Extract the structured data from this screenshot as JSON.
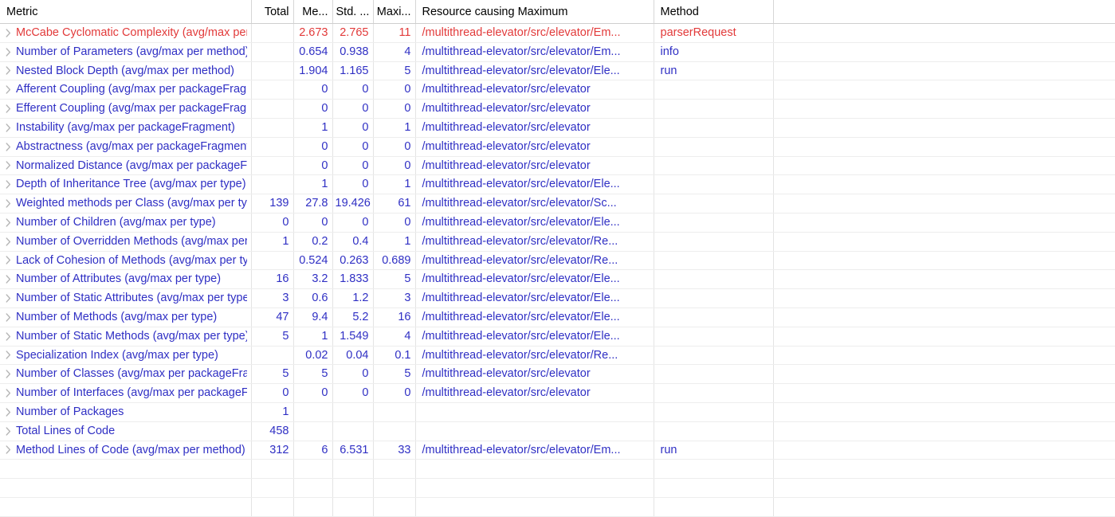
{
  "table": {
    "columns": [
      {
        "key": "metric",
        "label": "Metric",
        "align": "left"
      },
      {
        "key": "total",
        "label": "Total",
        "align": "right"
      },
      {
        "key": "mean",
        "label": "Me...",
        "align": "right"
      },
      {
        "key": "std",
        "label": "Std. ...",
        "align": "right"
      },
      {
        "key": "max",
        "label": "Maxi...",
        "align": "right"
      },
      {
        "key": "resource",
        "label": "Resource causing Maximum",
        "align": "left"
      },
      {
        "key": "method",
        "label": "Method",
        "align": "left"
      },
      {
        "key": "filler",
        "label": "",
        "align": "left"
      }
    ],
    "expander_icon": "chevron-right-icon",
    "colors": {
      "row_normal": "#2f2fc4",
      "row_highlight": "#e23a3a",
      "header_text": "#000000",
      "grid_line": "#e4e4e4",
      "expander": "#b4b4b4"
    },
    "rows": [
      {
        "metric": "McCabe Cyclomatic Complexity (avg/max per method)",
        "total": "",
        "mean": "2.673",
        "std": "2.765",
        "max": "11",
        "resource": "/multithread-elevator/src/elevator/Em...",
        "method": "parserRequest",
        "state": "highlight"
      },
      {
        "metric": "Number of Parameters (avg/max per method)",
        "total": "",
        "mean": "0.654",
        "std": "0.938",
        "max": "4",
        "resource": "/multithread-elevator/src/elevator/Em...",
        "method": "info",
        "state": "normal"
      },
      {
        "metric": "Nested Block Depth (avg/max per method)",
        "total": "",
        "mean": "1.904",
        "std": "1.165",
        "max": "5",
        "resource": "/multithread-elevator/src/elevator/Ele...",
        "method": "run",
        "state": "normal"
      },
      {
        "metric": "Afferent Coupling (avg/max per packageFragment)",
        "total": "",
        "mean": "0",
        "std": "0",
        "max": "0",
        "resource": "/multithread-elevator/src/elevator",
        "method": "",
        "state": "normal"
      },
      {
        "metric": "Efferent Coupling (avg/max per packageFragment)",
        "total": "",
        "mean": "0",
        "std": "0",
        "max": "0",
        "resource": "/multithread-elevator/src/elevator",
        "method": "",
        "state": "normal"
      },
      {
        "metric": "Instability (avg/max per packageFragment)",
        "total": "",
        "mean": "1",
        "std": "0",
        "max": "1",
        "resource": "/multithread-elevator/src/elevator",
        "method": "",
        "state": "normal"
      },
      {
        "metric": "Abstractness (avg/max per packageFragment)",
        "total": "",
        "mean": "0",
        "std": "0",
        "max": "0",
        "resource": "/multithread-elevator/src/elevator",
        "method": "",
        "state": "normal"
      },
      {
        "metric": "Normalized Distance (avg/max per packageFragment)",
        "total": "",
        "mean": "0",
        "std": "0",
        "max": "0",
        "resource": "/multithread-elevator/src/elevator",
        "method": "",
        "state": "normal"
      },
      {
        "metric": "Depth of Inheritance Tree (avg/max per type)",
        "total": "",
        "mean": "1",
        "std": "0",
        "max": "1",
        "resource": "/multithread-elevator/src/elevator/Ele...",
        "method": "",
        "state": "normal"
      },
      {
        "metric": "Weighted methods per Class (avg/max per type)",
        "total": "139",
        "mean": "27.8",
        "std": "19.426",
        "max": "61",
        "resource": "/multithread-elevator/src/elevator/Sc...",
        "method": "",
        "state": "normal"
      },
      {
        "metric": "Number of Children (avg/max per type)",
        "total": "0",
        "mean": "0",
        "std": "0",
        "max": "0",
        "resource": "/multithread-elevator/src/elevator/Ele...",
        "method": "",
        "state": "normal"
      },
      {
        "metric": "Number of Overridden Methods (avg/max per type)",
        "total": "1",
        "mean": "0.2",
        "std": "0.4",
        "max": "1",
        "resource": "/multithread-elevator/src/elevator/Re...",
        "method": "",
        "state": "normal"
      },
      {
        "metric": "Lack of Cohesion of Methods (avg/max per type)",
        "total": "",
        "mean": "0.524",
        "std": "0.263",
        "max": "0.689",
        "resource": "/multithread-elevator/src/elevator/Re...",
        "method": "",
        "state": "normal"
      },
      {
        "metric": "Number of Attributes (avg/max per type)",
        "total": "16",
        "mean": "3.2",
        "std": "1.833",
        "max": "5",
        "resource": "/multithread-elevator/src/elevator/Ele...",
        "method": "",
        "state": "normal"
      },
      {
        "metric": "Number of Static Attributes (avg/max per type)",
        "total": "3",
        "mean": "0.6",
        "std": "1.2",
        "max": "3",
        "resource": "/multithread-elevator/src/elevator/Ele...",
        "method": "",
        "state": "normal"
      },
      {
        "metric": "Number of Methods (avg/max per type)",
        "total": "47",
        "mean": "9.4",
        "std": "5.2",
        "max": "16",
        "resource": "/multithread-elevator/src/elevator/Ele...",
        "method": "",
        "state": "normal"
      },
      {
        "metric": "Number of Static Methods (avg/max per type)",
        "total": "5",
        "mean": "1",
        "std": "1.549",
        "max": "4",
        "resource": "/multithread-elevator/src/elevator/Ele...",
        "method": "",
        "state": "normal"
      },
      {
        "metric": "Specialization Index (avg/max per type)",
        "total": "",
        "mean": "0.02",
        "std": "0.04",
        "max": "0.1",
        "resource": "/multithread-elevator/src/elevator/Re...",
        "method": "",
        "state": "normal"
      },
      {
        "metric": "Number of Classes (avg/max per packageFragment)",
        "total": "5",
        "mean": "5",
        "std": "0",
        "max": "5",
        "resource": "/multithread-elevator/src/elevator",
        "method": "",
        "state": "normal"
      },
      {
        "metric": "Number of Interfaces (avg/max per packageFragment)",
        "total": "0",
        "mean": "0",
        "std": "0",
        "max": "0",
        "resource": "/multithread-elevator/src/elevator",
        "method": "",
        "state": "normal"
      },
      {
        "metric": "Number of Packages",
        "total": "1",
        "mean": "",
        "std": "",
        "max": "",
        "resource": "",
        "method": "",
        "state": "normal"
      },
      {
        "metric": "Total Lines of Code",
        "total": "458",
        "mean": "",
        "std": "",
        "max": "",
        "resource": "",
        "method": "",
        "state": "normal"
      },
      {
        "metric": "Method Lines of Code (avg/max per method)",
        "total": "312",
        "mean": "6",
        "std": "6.531",
        "max": "33",
        "resource": "/multithread-elevator/src/elevator/Em...",
        "method": "run",
        "state": "normal"
      }
    ],
    "empty_row_count": 3
  }
}
